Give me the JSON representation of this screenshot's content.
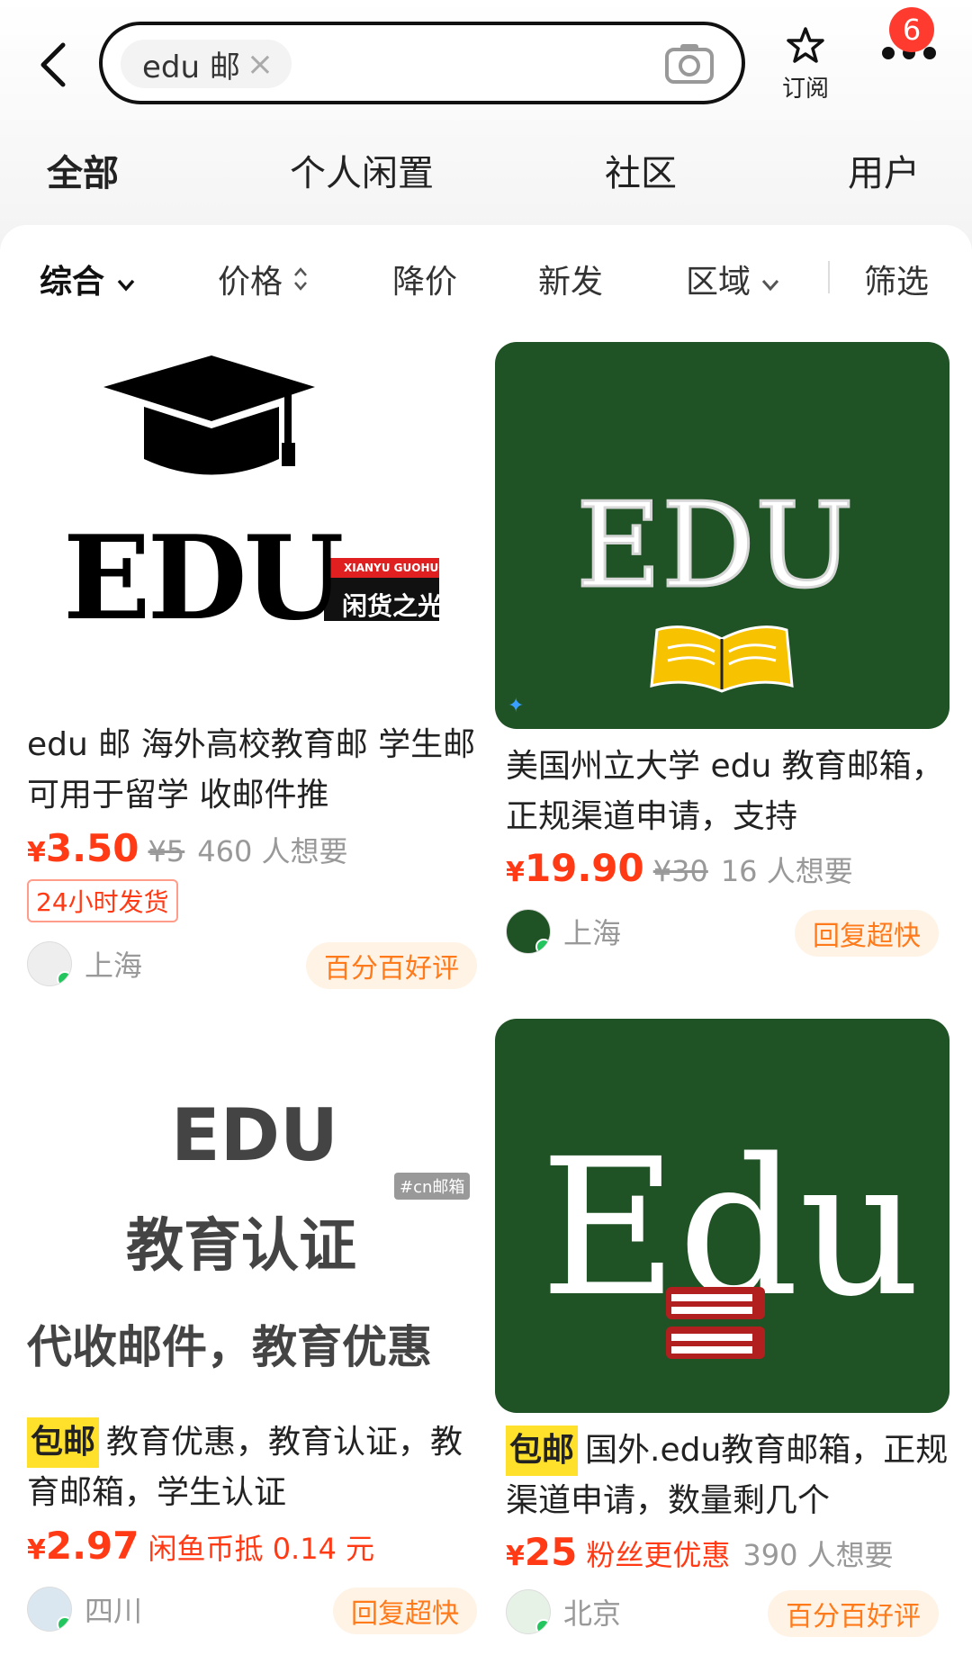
{
  "header": {
    "search_chip": "edu 邮",
    "subscribe_label": "订阅",
    "notify_count": "6"
  },
  "tabs": [
    "全部",
    "个人闲置",
    "社区",
    "用户"
  ],
  "filters": [
    "综合",
    "价格",
    "降价",
    "新发",
    "区域",
    "筛选"
  ],
  "products": [
    {
      "image_text": "EDU",
      "image_watermark": "闲货之光",
      "image_watermark_en": "XIANYU GUOHUO",
      "title": "edu 邮 海外高校教育邮 学生邮 可用于留学 收邮件推",
      "yen": "¥",
      "price": "3.50",
      "original": "¥5",
      "wants": "460 人想要",
      "fast_tag": "24小时发货",
      "location": "上海",
      "pill": "百分百好评"
    },
    {
      "image_text": "EDU",
      "title": "美国州立大学 edu 教育邮箱，正规渠道申请，支持",
      "yen": "¥",
      "price": "19.90",
      "original": "¥30",
      "wants": "16 人想要",
      "location": "上海",
      "pill": "回复超快"
    },
    {
      "image_line1": "EDU",
      "image_line2": "教育认证",
      "image_line3": "代收邮件，教育优惠",
      "image_tag": "#cn邮箱",
      "free_tag": "包邮",
      "title": "教育优惠，教育认证，教育邮箱，学生认证",
      "yen": "¥",
      "price": "2.97",
      "promo": "闲鱼币抵 0.14 元",
      "location": "四川",
      "pill": "回复超快"
    },
    {
      "image_text": "Edu",
      "free_tag": "包邮",
      "title": "国外.edu教育邮箱，正规渠道申请，数量剩几个",
      "yen": "¥",
      "price": "25",
      "promo": "粉丝更优惠",
      "wants": "390 人想要",
      "location": "北京",
      "pill": "百分百好评"
    }
  ]
}
